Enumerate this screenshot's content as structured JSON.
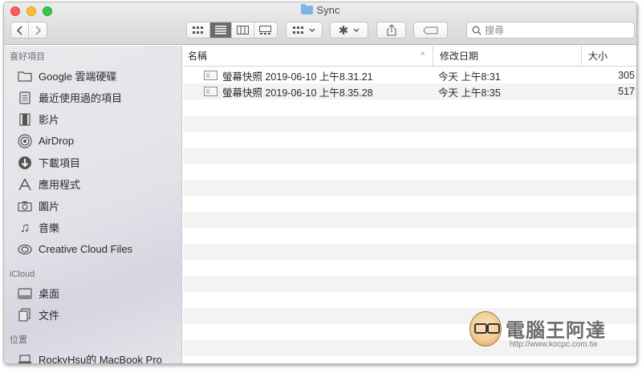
{
  "window": {
    "title": "Sync"
  },
  "toolbar": {
    "back_icon": "chevron-left",
    "forward_icon": "chevron-right",
    "view_modes": [
      "icon",
      "list",
      "column",
      "gallery"
    ],
    "active_view": "list",
    "group_icon": "grid-arrange",
    "action_icon": "gear",
    "share_icon": "share",
    "tag_icon": "tag",
    "search_placeholder": "搜尋"
  },
  "sidebar": {
    "sections": [
      {
        "heading": "喜好項目",
        "items": [
          {
            "label": "Google 雲端硬碟",
            "icon": "folder-icon"
          },
          {
            "label": "最近使用過的項目",
            "icon": "recents-icon"
          },
          {
            "label": "影片",
            "icon": "film-icon"
          },
          {
            "label": "AirDrop",
            "icon": "airdrop-icon"
          },
          {
            "label": "下載項目",
            "icon": "download-icon"
          },
          {
            "label": "應用程式",
            "icon": "applications-icon"
          },
          {
            "label": "圖片",
            "icon": "camera-icon"
          },
          {
            "label": "音樂",
            "icon": "music-icon"
          },
          {
            "label": "Creative Cloud Files",
            "icon": "creative-cloud-icon"
          }
        ]
      },
      {
        "heading": "iCloud",
        "items": [
          {
            "label": "桌面",
            "icon": "desktop-icon"
          },
          {
            "label": "文件",
            "icon": "documents-icon"
          }
        ]
      },
      {
        "heading": "位置",
        "items": [
          {
            "label": "RockyHsu的 MacBook Pro",
            "icon": "laptop-icon"
          }
        ]
      }
    ]
  },
  "list": {
    "columns": {
      "name": "名稱",
      "date": "修改日期",
      "size": "大小"
    },
    "rows": [
      {
        "name": "螢幕快照 2019-06-10 上午8.31.21",
        "date": "今天 上午8:31",
        "size": "305"
      },
      {
        "name": "螢幕快照 2019-06-10 上午8.35.28",
        "date": "今天 上午8:35",
        "size": "517"
      }
    ]
  },
  "watermark": {
    "title": "電腦王阿達",
    "url": "http://www.kocpc.com.tw"
  },
  "colors": {
    "close": "#fc5f57",
    "minimize": "#fdbc2e",
    "maximize": "#34c84a",
    "folder": "#7db3e8"
  }
}
